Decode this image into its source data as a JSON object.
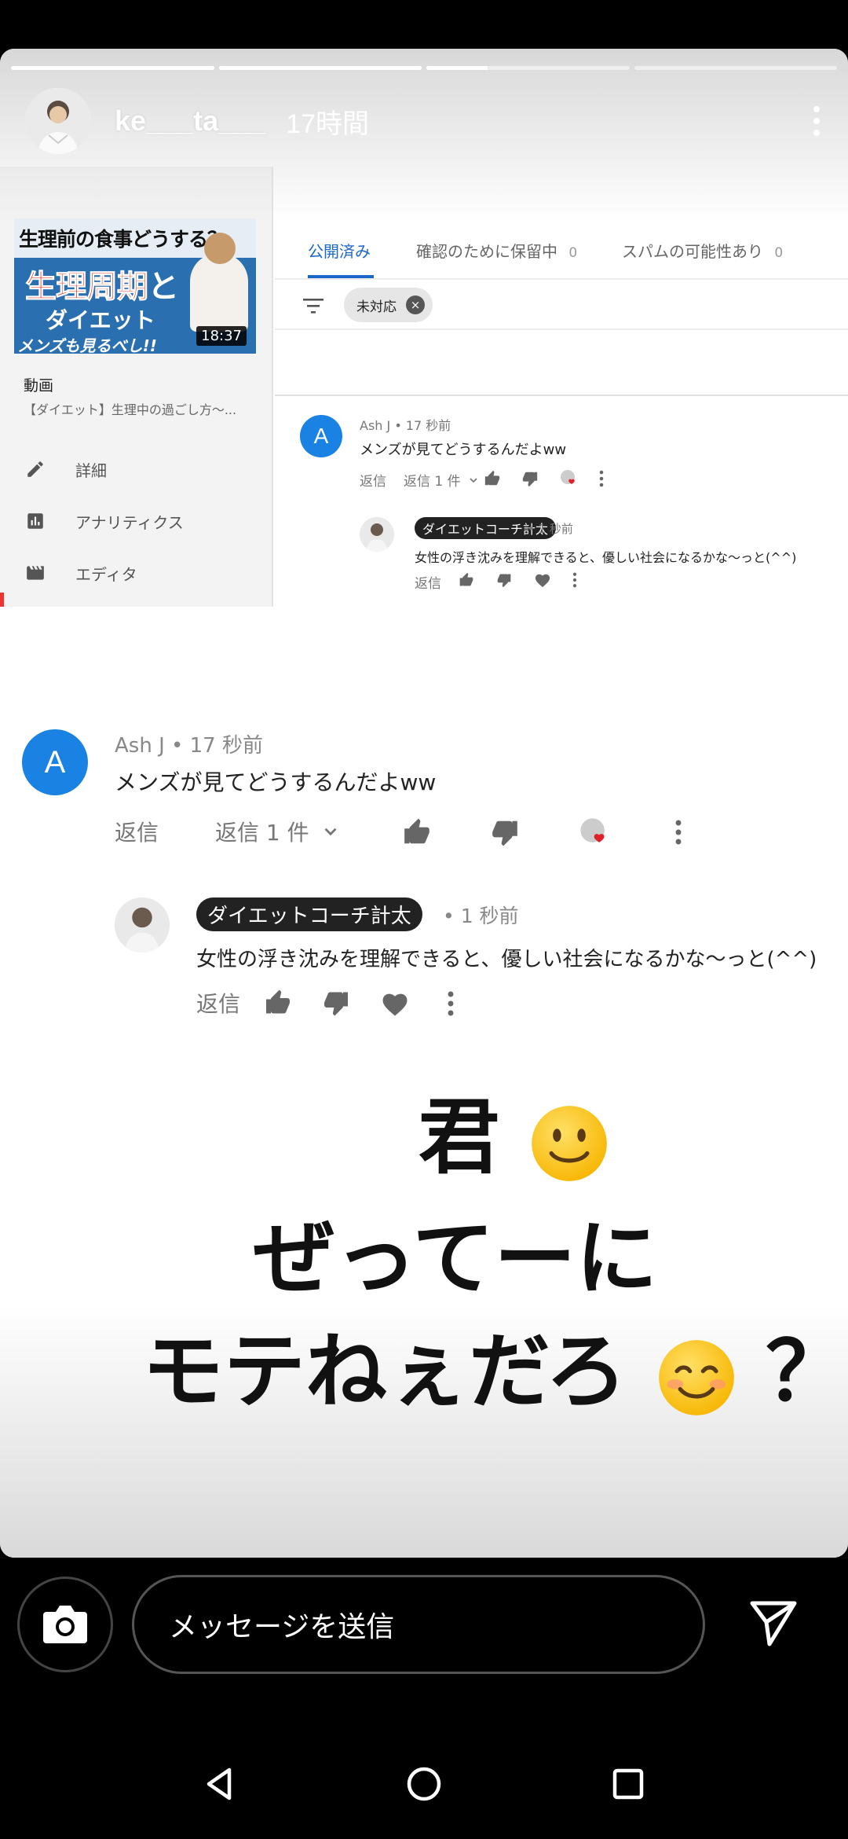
{
  "story": {
    "username": "ke___ta___",
    "time": "17時間",
    "progress": [
      1,
      1,
      0.3,
      0
    ]
  },
  "studio": {
    "thumbnail": {
      "line1": "生理前の食事どうする？",
      "line2a": "生理周期",
      "line2b": "と",
      "line3": "ダイエット",
      "line4": "メンズも見るべし!!",
      "duration": "18:37"
    },
    "video_label": "動画",
    "video_title": "【ダイエット】生理中の過ごし方〜...",
    "nav": [
      {
        "label": "詳細",
        "icon": "pencil-icon"
      },
      {
        "label": "アナリティクス",
        "icon": "analytics-icon"
      },
      {
        "label": "エディタ",
        "icon": "clapperboard-icon"
      }
    ],
    "tabs": [
      {
        "label": "公開済み",
        "count": ""
      },
      {
        "label": "確認のために保留中",
        "count": "0"
      },
      {
        "label": "スパムの可能性あり",
        "count": "0"
      }
    ],
    "filter_chip": "未対応"
  },
  "comment": {
    "avatar_letter": "A",
    "author": "Ash J",
    "time": "17 秒前",
    "text": "メンズが見てどうするんだよww",
    "reply_label": "返信",
    "replies_label": "返信 1 件",
    "reply": {
      "author": "ダイエットコーチ計太",
      "time": "1 秒前",
      "text": "女性の浮き沈みを理解できると、優しい社会になるかな〜っと(^^)",
      "reply_label": "返信"
    }
  },
  "sticker": {
    "line1": "君",
    "line2": "ぜってーに",
    "line3": "モテねぇだろ",
    "line3_end": "？"
  },
  "composer": {
    "placeholder": "メッセージを送信"
  },
  "colors": {
    "accent_blue": "#1b66c9",
    "avatar_blue": "#1a82e2",
    "heart_red": "#e0202a"
  }
}
